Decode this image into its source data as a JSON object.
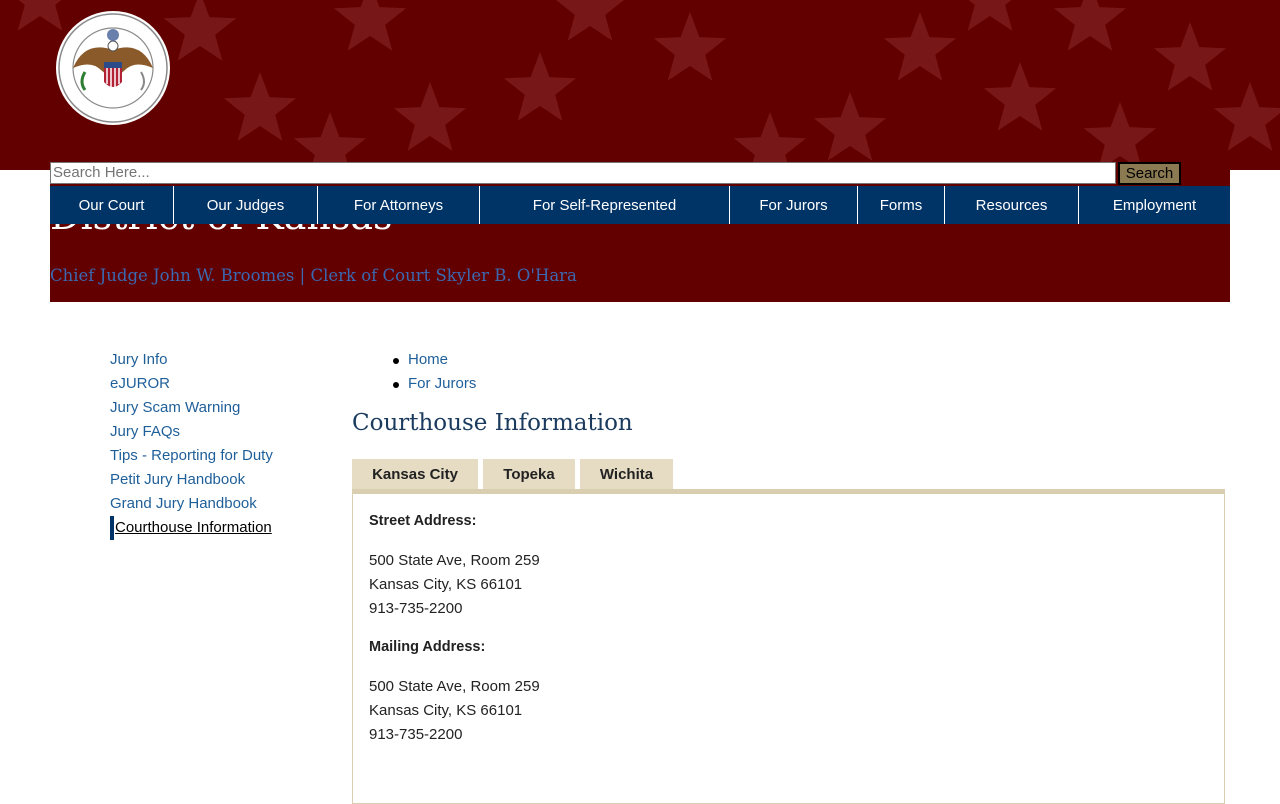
{
  "header": {
    "site_title": "District of Kansas",
    "officials": "Chief Judge John W. Broomes | Clerk of Court Skyler B. O'Hara",
    "seal_text": "UNITED STATES DISTRICT COURT DISTRICT OF KANSAS"
  },
  "search": {
    "placeholder": "Search Here...",
    "button_label": "Search"
  },
  "nav": {
    "items": [
      {
        "label": "Our Court"
      },
      {
        "label": "Our Judges"
      },
      {
        "label": "For Attorneys"
      },
      {
        "label": "For Self-Represented"
      },
      {
        "label": "For Jurors"
      },
      {
        "label": "Forms"
      },
      {
        "label": "Resources"
      },
      {
        "label": "Employment"
      }
    ]
  },
  "sidebar": {
    "items": [
      {
        "label": "Jury Info"
      },
      {
        "label": "eJUROR"
      },
      {
        "label": "Jury Scam Warning"
      },
      {
        "label": "Jury FAQs"
      },
      {
        "label": "Tips - Reporting for Duty"
      },
      {
        "label": "Petit Jury Handbook"
      },
      {
        "label": "Grand Jury Handbook"
      },
      {
        "label": "Courthouse Information",
        "active": true
      }
    ]
  },
  "breadcrumb": {
    "items": [
      {
        "label": "Home"
      },
      {
        "label": "For Jurors"
      }
    ]
  },
  "page": {
    "title": "Courthouse Information"
  },
  "tabs": {
    "items": [
      {
        "label": "Kansas City",
        "selected": true
      },
      {
        "label": "Topeka"
      },
      {
        "label": "Wichita"
      }
    ]
  },
  "panel": {
    "street_label": "Street Address:",
    "street_lines": [
      "500 State Ave, Room 259",
      "Kansas City, KS 66101",
      "913-735-2200"
    ],
    "mailing_label": "Mailing Address:",
    "mailing_lines": [
      "500 State Ave, Room 259",
      "Kansas City, KS 66101",
      "913-735-2200"
    ]
  },
  "colors": {
    "banner": "#620000",
    "nav": "#003366",
    "link": "#1f5f99",
    "tab": "#e5dcc3",
    "search_button": "#8b7a52"
  }
}
